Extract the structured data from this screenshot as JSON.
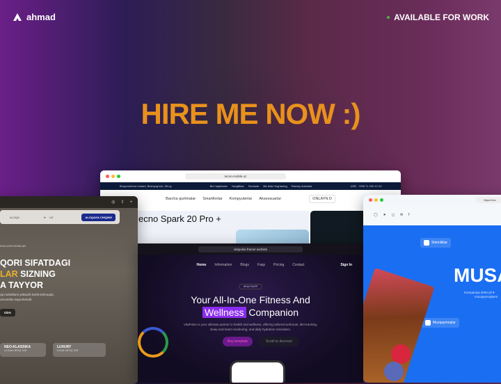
{
  "header": {
    "logo_text": "ahmad",
    "status": "AVAILABLE FOR WORK",
    "status_color": "#4caf50"
  },
  "hero": {
    "title": "HIRE ME NOW :)",
    "color": "#e8911c"
  },
  "tecno": {
    "url": "tecno-mobile.uz",
    "strip_left": "Shayxontohur tumani, Beshyog'och, 59-uy",
    "strip_links": [
      "Biz haqimizda",
      "Yangiliklar",
      "Servislar",
      "Biz bilan bog'laning",
      "Rasmiy dokonlar"
    ],
    "lang": "UZB",
    "phone": "+998 71 200 12 20",
    "nav": [
      "Barcha qurilmalar",
      "Smartfonlar",
      "Kompyuterlar",
      "Aksessuarlar"
    ],
    "cta": "ONLAYN D",
    "product": "ecno Spark 20 Pro +"
  },
  "kitchen": {
    "nav_item": "ALOQA",
    "lang": "UZ",
    "cta": "ALOQAGA CHIQING",
    "tag": "EXKLUZIV EKSKLAR",
    "headline": [
      "QORI SIFATDAGI",
      "LAR SIZNING",
      "A TAYYOR"
    ],
    "headline_highlight": "LAR",
    "subtitle": [
      "rgi mebellarni yetkazib berib kelmoqda.",
      "omonidan tayyorlanadi."
    ],
    "button": "ODA",
    "cards": [
      {
        "title": "NEO-KLASSIKA",
        "sub": "14 DAN ORTIQ TUR"
      },
      {
        "title": "LUXURY",
        "sub": "8 DAN ORTIQ TUR"
      }
    ]
  },
  "vitapulse": {
    "url": "vitapulse.framer.website",
    "nav": [
      "Home",
      "Information",
      "Blogs",
      "Faqs",
      "Pricing",
      "Contact"
    ],
    "sign_in": "Sign In",
    "badge": "HEALTHAPP",
    "title_line1": "Your All-In-One Fitness And",
    "title_highlight": "Wellness",
    "title_rest": "Companion",
    "description": "VitaPulse is your ultimate partner in health and wellness, offering tailored workouts, diet tracking, sleep and heart monitoring, and daily hydration reminders.",
    "buy": "Buy template",
    "scroll": "Scroll to discover",
    "accent": "#8b2cf0"
  },
  "musa": {
    "url": "https://mu",
    "brand": "MUSA",
    "subtitle": [
      "Kompaniya 2004-yil 9-",
      "muzqaymoqlarni"
    ],
    "chips": [
      "Shirinliklar",
      "Muzqaymoqlar"
    ],
    "accent": "#1a6ef2"
  }
}
